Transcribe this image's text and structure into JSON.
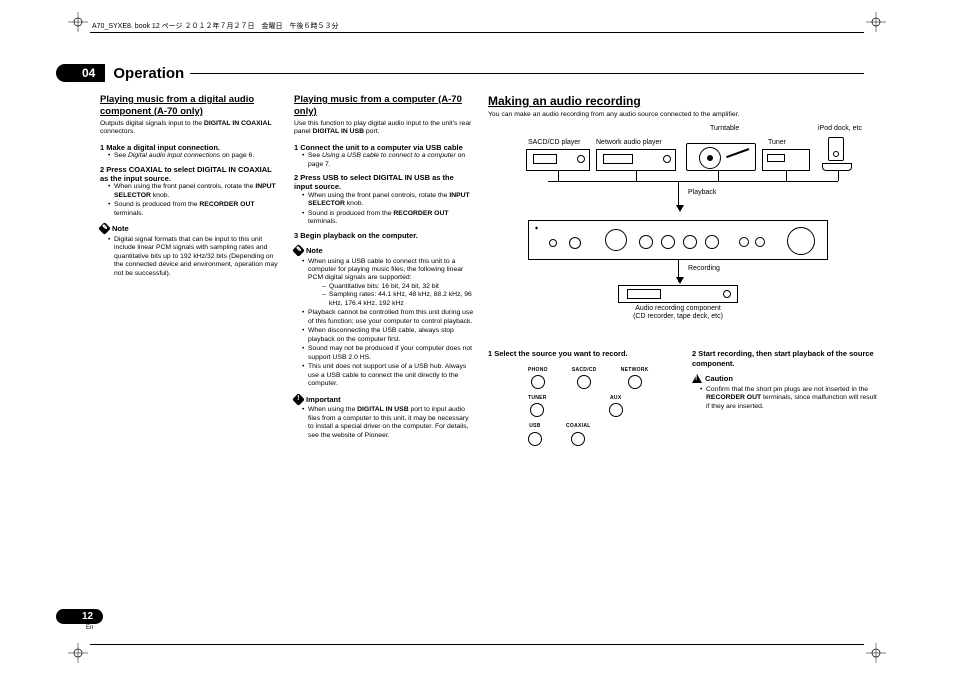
{
  "meta": {
    "book_info": "A70_SYXE8. book  12 ページ  ２０１２年７月２７日　金曜日　午後６時５３分"
  },
  "section": {
    "number": "04",
    "title": "Operation"
  },
  "col1": {
    "heading1": "Playing music from a digital audio",
    "heading2": "component (A-70 only)",
    "intro_a": "Outputs digital signals input to the ",
    "intro_b": "DIGITAL IN COAXIAL",
    "intro_c": " connectors.",
    "step1": "1   Make a digital input connection.",
    "step1_bullet_a": "See ",
    "step1_bullet_b": "Digital audio input connections",
    "step1_bullet_c": " on page 6.",
    "step2": "2   Press COAXIAL to select DIGITAL IN COAXIAL as the input source.",
    "step2_b1_a": "When using the front panel controls, rotate the ",
    "step2_b1_b": "INPUT SELECTOR",
    "step2_b1_c": " knob.",
    "step2_b2_a": "Sound is produced from the ",
    "step2_b2_b": "RECORDER OUT",
    "step2_b2_c": " terminals.",
    "note_label": "Note",
    "note_text": "Digital signal formats that can be input to this unit include linear PCM signals with sampling rates and quantitative bits up to 192 kHz/32 bits (Depending on the connected device and environment, operation may not be successful)."
  },
  "col2": {
    "heading": "Playing music from a computer (A-70 only)",
    "intro_a": "Use this function to play digital audio input to the unit's rear panel ",
    "intro_b": "DIGITAL IN USB",
    "intro_c": " port.",
    "step1": "1   Connect the unit to a computer via USB cable",
    "step1_b_a": "See ",
    "step1_b_b": "Using a USB cable to connect to a computer",
    "step1_b_c": " on page 7.",
    "step2": "2   Press USB to select DIGITAL IN USB as the input source.",
    "step2_b1_a": "When using the front panel controls, rotate the ",
    "step2_b1_b": "INPUT SELECTOR",
    "step2_b1_c": " knob.",
    "step2_b2_a": "Sound is produced from the ",
    "step2_b2_b": "RECORDER OUT",
    "step2_b2_c": " terminals.",
    "step3": "3   Begin playback on the computer.",
    "note_label": "Note",
    "note_b1": "When using a USB cable to connect this unit to a computer for playing music files, the following linear PCM digital signals are supported:",
    "note_b1_s1": "Quantitative bits: 16 bit, 24 bit, 32 bit",
    "note_b1_s2": "Sampling rates: 44.1 kHz, 48 kHz, 88.2 kHz, 96 kHz, 176.4 kHz, 192 kHz",
    "note_b2": "Playback cannot be controlled from this unit during use of this function; use your computer to control playback.",
    "note_b3": "When disconnecting the USB cable, always stop playback on the computer first.",
    "note_b4": "Sound may not be produced if your computer does not support USB 2.0 HS.",
    "note_b5": "This unit does not support use of a USB hub. Always use a USB cable to connect the unit directly to the computer.",
    "imp_label": "Important",
    "imp_b1_a": "When using the ",
    "imp_b1_b": "DIGITAL IN USB",
    "imp_b1_c": " port to input audio files from a computer to this unit, it may be necessary to install a special driver on the computer. For details, see the website of Pioneer."
  },
  "col3": {
    "heading": "Making an audio recording",
    "intro": "You can make an audio recording from any audio source connected to the amplifier.",
    "diagram": {
      "sacd": "SACD/CD player",
      "nap": "Network audio player",
      "turntable": "Turntable",
      "tuner": "Tuner",
      "ipod": "iPod dock, etc",
      "playback": "Playback",
      "recording": "Recording",
      "recorder1": "Audio recording component",
      "recorder2": "(CD recorder, tape deck, etc)"
    },
    "step1": "1   Select the source you want to record.",
    "selectors": [
      [
        "PHONO",
        "SACD/CD",
        "NETWORK"
      ],
      [
        "TUNER",
        "",
        "AUX"
      ],
      [
        "USB",
        "COAXIAL",
        ""
      ]
    ],
    "step2": "2   Start recording, then start playback of the source component.",
    "caution_label": "Caution",
    "caution_a": "Confirm that the short pin plugs are not inserted in the ",
    "caution_b": "RECORDER OUT",
    "caution_c": " terminals, since malfunction will result if they are inserted."
  },
  "footer": {
    "page": "12",
    "lang": "En"
  }
}
